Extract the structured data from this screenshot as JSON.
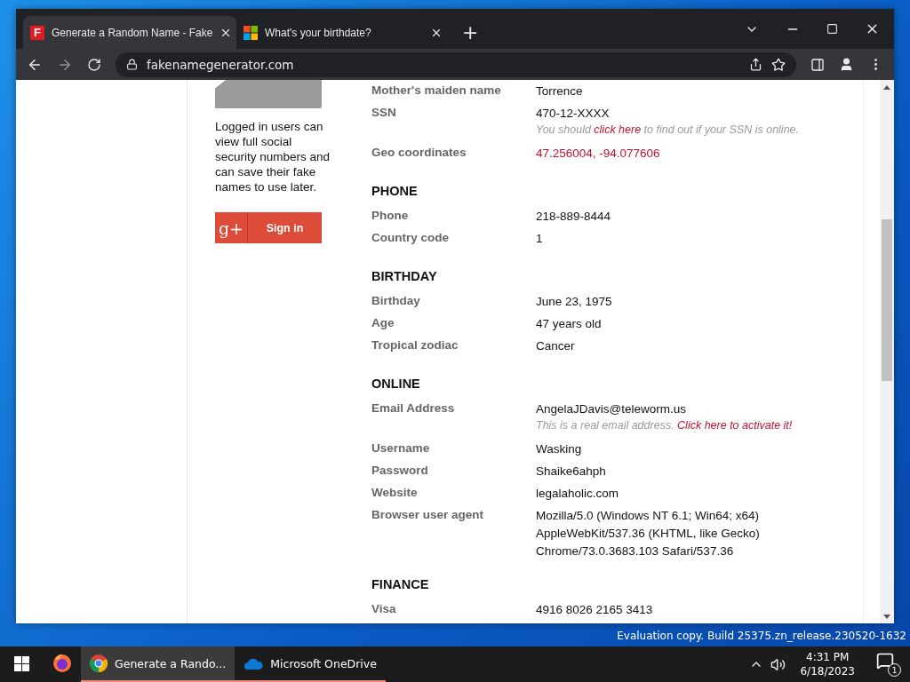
{
  "browser": {
    "tabs": [
      {
        "favicon": "F",
        "kind": "letter",
        "title": "Generate a Random Name - Fake",
        "selected": true
      },
      {
        "kind": "squares",
        "title": "What's your birthdate?",
        "selected": false
      }
    ],
    "new_tab": "+",
    "address": "fakenamegenerator.com"
  },
  "sidebar": {
    "notice": "Logged in users can view full social security numbers and can save their fake names to use later.",
    "sign_in": {
      "icon": "g+",
      "label": "Sign in"
    }
  },
  "sections": [
    {
      "rows": [
        {
          "label": "Mother's maiden name",
          "value": "Torrence",
          "kind": "text"
        },
        {
          "label": "SSN",
          "value": "470-12-XXXX",
          "kind": "text",
          "note": {
            "before": "You should ",
            "link": "click here",
            "after": " to find out if your SSN is online."
          }
        },
        {
          "label": "Geo coordinates",
          "value": "47.256004, -94.077606",
          "kind": "link"
        }
      ]
    },
    {
      "heading": "PHONE",
      "rows": [
        {
          "label": "Phone",
          "value": "218-889-8444",
          "kind": "text"
        },
        {
          "label": "Country code",
          "value": "1",
          "kind": "text"
        }
      ]
    },
    {
      "heading": "BIRTHDAY",
      "rows": [
        {
          "label": "Birthday",
          "value": "June 23, 1975",
          "kind": "text"
        },
        {
          "label": "Age",
          "value": "47 years old",
          "kind": "text"
        },
        {
          "label": "Tropical zodiac",
          "value": "Cancer",
          "kind": "text"
        }
      ]
    },
    {
      "heading": "ONLINE",
      "rows": [
        {
          "label": "Email Address",
          "value": "AngelaJDavis@teleworm.us",
          "kind": "text",
          "note": {
            "before": "This is a real email address. ",
            "link": "Click here to activate it!"
          }
        },
        {
          "label": "Username",
          "value": "Wasking",
          "kind": "text"
        },
        {
          "label": "Password",
          "value": "Shaike6ahph",
          "kind": "text"
        },
        {
          "label": "Website",
          "value": "legalaholic.com",
          "kind": "text"
        },
        {
          "label": "Browser user agent",
          "lines": [
            "Mozilla/5.0 (Windows NT 6.1; Win64; x64)",
            "AppleWebKit/537.36 (KHTML, like Gecko)",
            "Chrome/73.0.3683.103 Safari/537.36"
          ],
          "kind": "text"
        }
      ]
    },
    {
      "heading": "FINANCE",
      "rows": [
        {
          "label": "Visa",
          "value": "4916 8026 2165 3413",
          "kind": "text"
        }
      ]
    }
  ],
  "desktop": {
    "watermark": "Evaluation copy. Build 25375.zn_release.230520-1632"
  },
  "taskbar": {
    "items": [
      {
        "kind": "firefox",
        "selected": false,
        "running": false
      },
      {
        "kind": "chrome",
        "label": "Generate a Rando...",
        "selected": true,
        "running": true
      },
      {
        "kind": "onedrive",
        "label": "Microsoft OneDrive",
        "selected": false,
        "running": true
      }
    ],
    "time": "4:31 PM",
    "date": "6/18/2023",
    "notifications": "1"
  }
}
